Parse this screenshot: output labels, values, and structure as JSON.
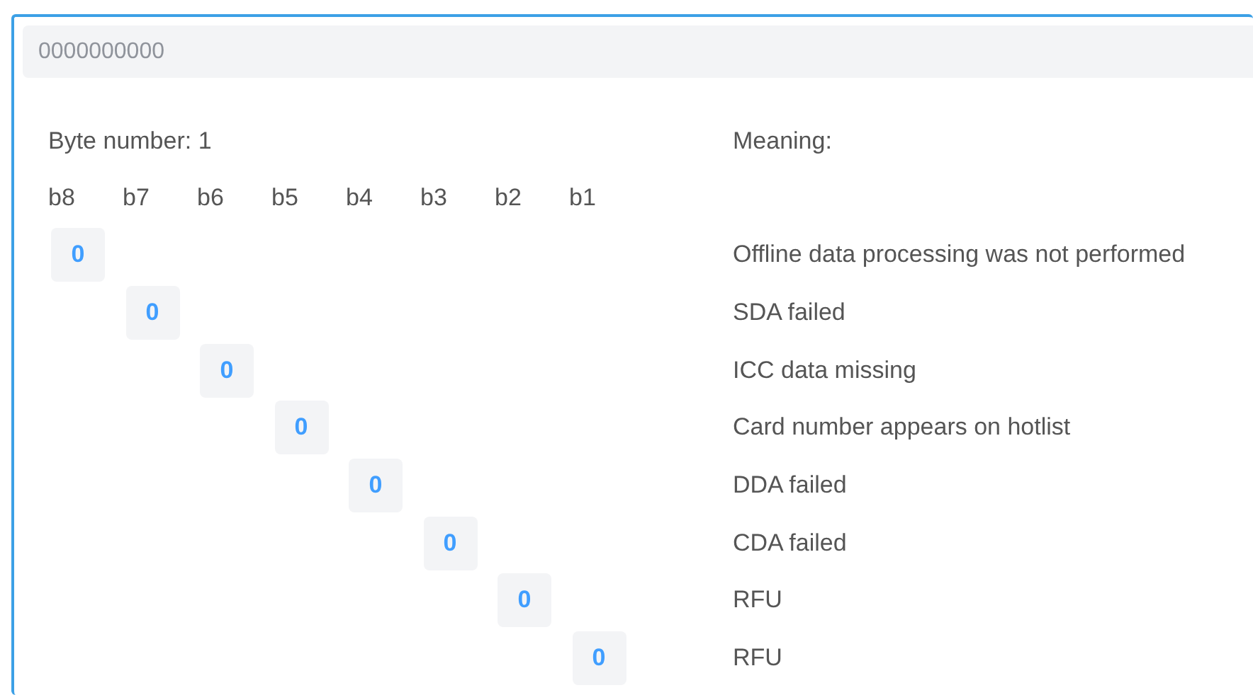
{
  "hex_field": {
    "placeholder": "0000000000"
  },
  "byte_label": "Byte number: 1",
  "meaning_label": "Meaning:",
  "bit_headers": [
    "b8",
    "b7",
    "b6",
    "b5",
    "b4",
    "b3",
    "b2",
    "b1"
  ],
  "bits": [
    {
      "value": "0",
      "meaning": "Offline data processing was not performed"
    },
    {
      "value": "0",
      "meaning": "SDA failed"
    },
    {
      "value": "0",
      "meaning": "ICC data missing"
    },
    {
      "value": "0",
      "meaning": "Card number appears on hotlist"
    },
    {
      "value": "0",
      "meaning": "DDA failed"
    },
    {
      "value": "0",
      "meaning": "CDA failed"
    },
    {
      "value": "0",
      "meaning": "RFU"
    },
    {
      "value": "0",
      "meaning": "RFU"
    }
  ]
}
